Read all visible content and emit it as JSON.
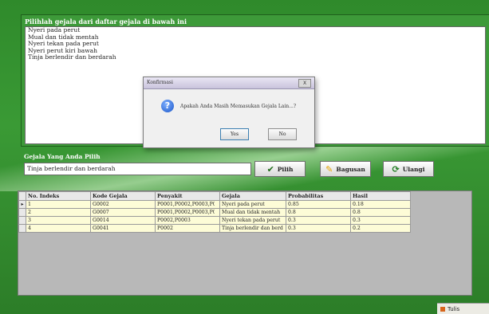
{
  "symptom_panel": {
    "title": "Pilihlah gejala dari daftar gejala di bawah ini",
    "items": [
      "Nyeri pada perut",
      "Mual dan tidak mentah",
      "Nyeri tekan pada perut",
      "Nyeri perut kiri bawah",
      "Tinja berlendir dan berdarah"
    ]
  },
  "dialog": {
    "title": "Konfirmasi",
    "message": "Apakah Anda Masih Memasukan Gejala Lain...?",
    "yes_label": "Yes",
    "no_label": "No",
    "close_label": "X",
    "icon": "question-icon"
  },
  "selected_panel": {
    "title": "Gejala Yang Anda Pilih",
    "value": "Tinja berlendir dan berdarah"
  },
  "actions": {
    "pilih_label": "Pilih",
    "bagusan_label": "Bagusan",
    "ulangi_label": "Ulangi"
  },
  "table": {
    "columns": [
      "No. Indeks",
      "Kode Gejala",
      "Penyakit",
      "Gejala",
      "Probabilitas",
      "Hasil"
    ],
    "rows": [
      [
        "1",
        "G0002",
        "P0001,P0002,P0003,P0004",
        "Nyeri pada perut",
        "0.85",
        "0.18"
      ],
      [
        "2",
        "G0007",
        "P0001,P0002,P0003,P0004",
        "Mual dan tidak mentah",
        "0.8",
        "0.8"
      ],
      [
        "3",
        "G0014",
        "P0002,P0003",
        "Nyeri tekan pada perut",
        "0.3",
        "0.3"
      ],
      [
        "4",
        "G0041",
        "P0002",
        "Tinja berlendir dan berd",
        "0.3",
        "0.2"
      ]
    ]
  },
  "taskbar": {
    "label": "Tulis"
  },
  "colors": {
    "background": "#2f8a2b",
    "grid_row": "#fdfcd7"
  }
}
